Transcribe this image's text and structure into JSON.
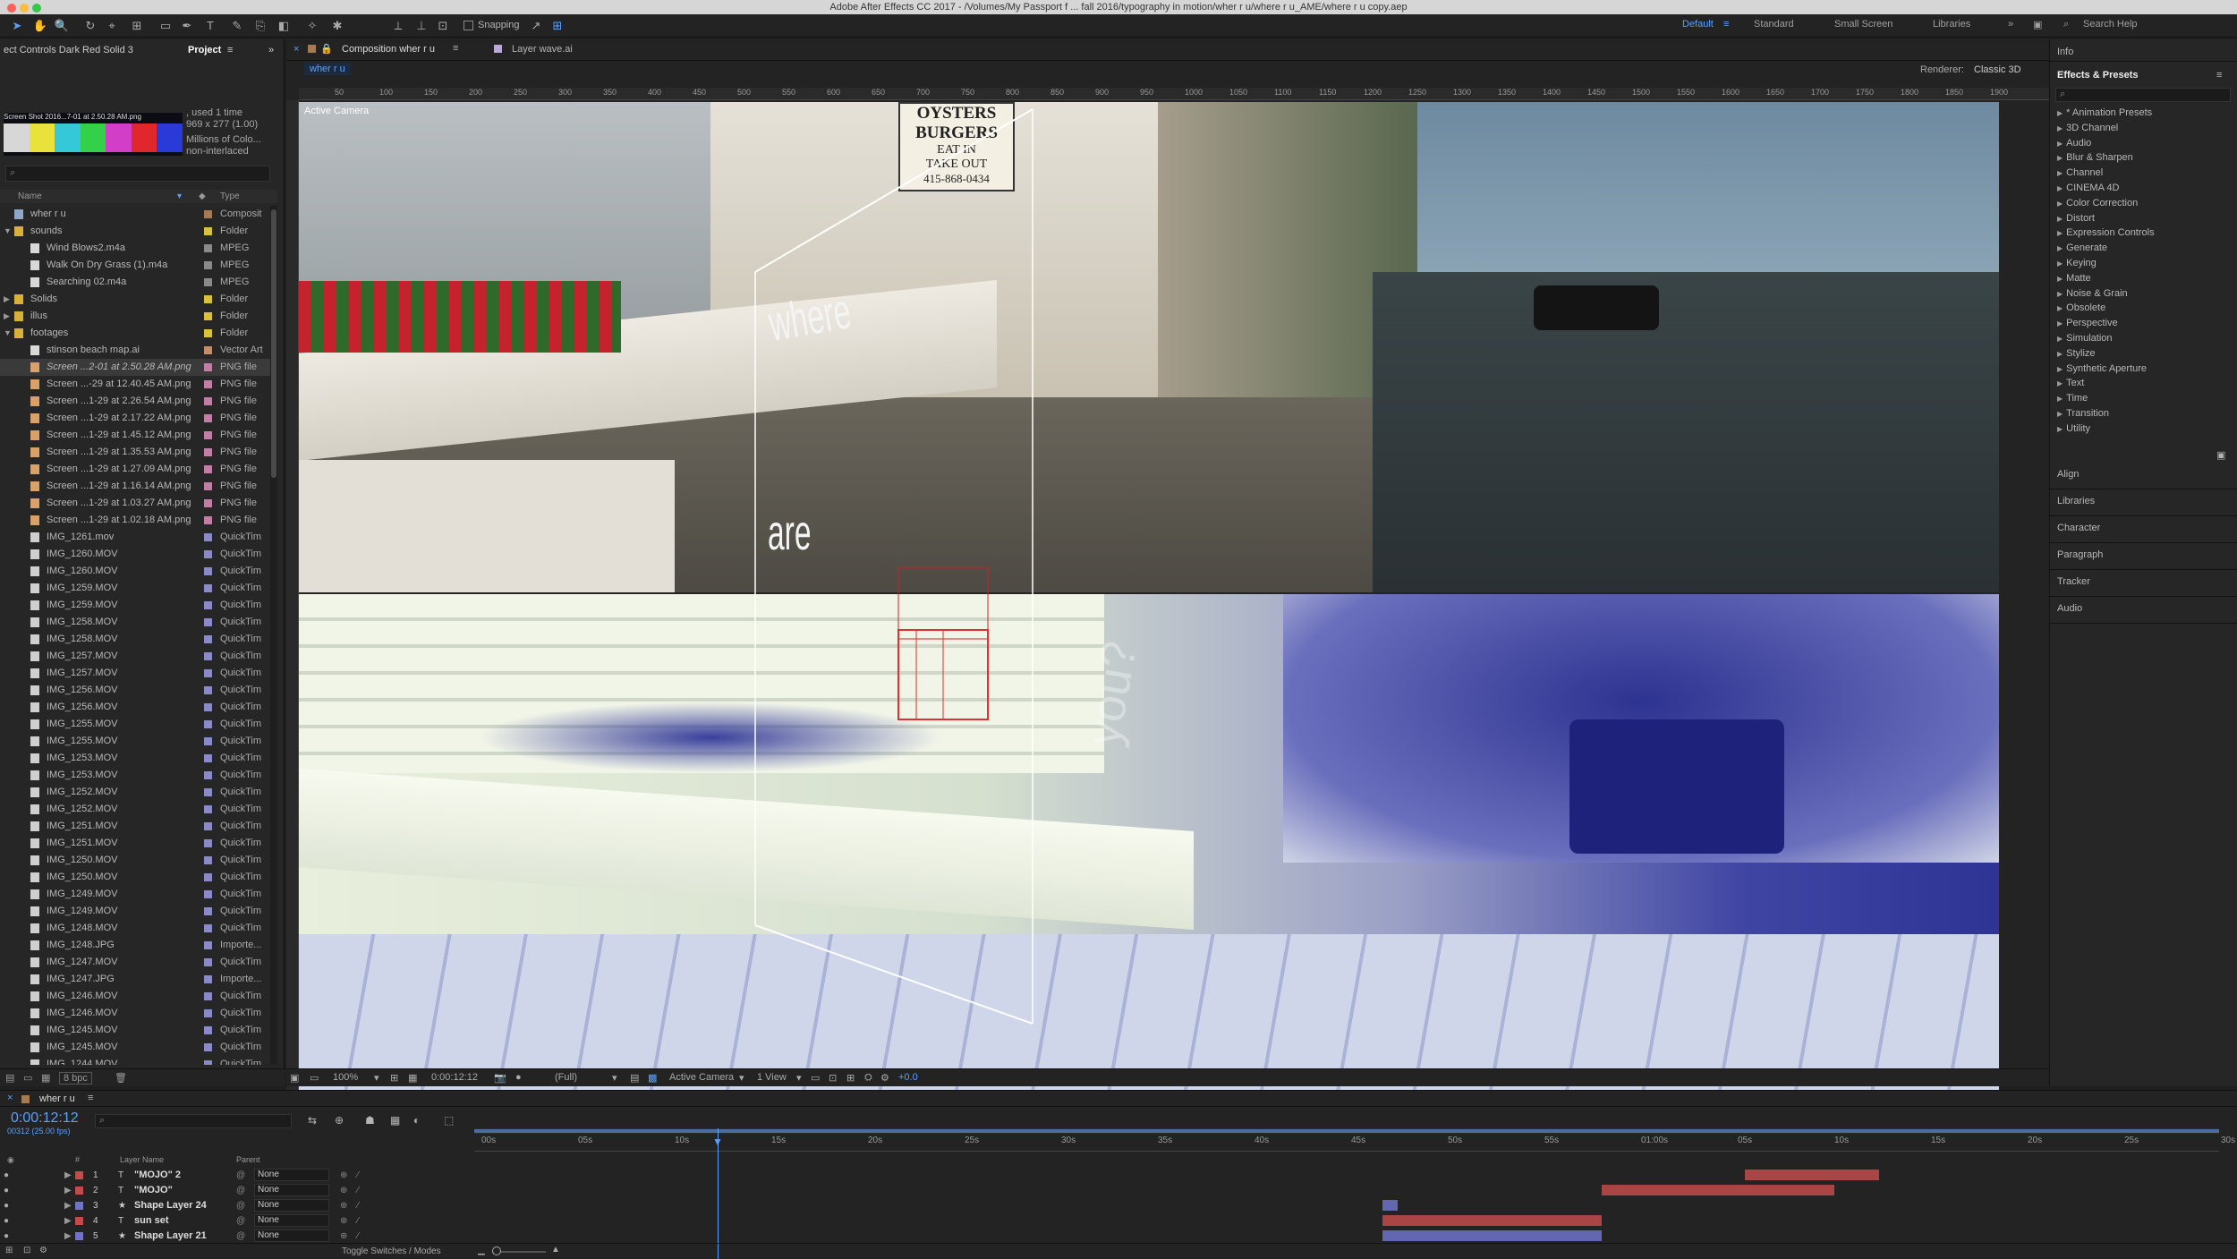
{
  "app": {
    "title": "Adobe After Effects CC 2017 - /Volumes/My Passport f ... fall 2016/typography in motion/wher r u/where r u_AME/where r u copy.aep"
  },
  "toolbar": {
    "snapping": "Snapping",
    "workspaces": [
      "Default",
      "Standard",
      "Small Screen",
      "Libraries"
    ],
    "search_help": "Search Help"
  },
  "left_panel": {
    "tabs": [
      "ect Controls Dark Red Solid 3",
      "Project"
    ],
    "footage_info": {
      "name": "Screen Shot 2016...7-01 at 2.50.28 AM.png",
      "used": ", used 1 time",
      "size": "969 x 277 (1.00)",
      "colors": "Millions of Colo...",
      "interlace": "non-interlaced"
    },
    "columns": {
      "name": "Name",
      "type": "Type"
    },
    "items": [
      {
        "name": "wher r u",
        "type": "Composit",
        "kind": "comp",
        "indent": 0,
        "label": "#a77b52"
      },
      {
        "name": "sounds",
        "type": "Folder",
        "kind": "folder",
        "indent": 0,
        "label": "#d8c23a"
      },
      {
        "name": "Wind Blows2.m4a",
        "type": "MPEG",
        "kind": "file",
        "indent": 1,
        "label": "#8a8a8a"
      },
      {
        "name": "Walk On Dry Grass (1).m4a",
        "type": "MPEG",
        "kind": "file",
        "indent": 1,
        "label": "#8a8a8a"
      },
      {
        "name": "Searching 02.m4a",
        "type": "MPEG",
        "kind": "file",
        "indent": 1,
        "label": "#8a8a8a"
      },
      {
        "name": "Solids",
        "type": "Folder",
        "kind": "folder",
        "indent": 0,
        "label": "#d8c23a"
      },
      {
        "name": "illus",
        "type": "Folder",
        "kind": "folder",
        "indent": 0,
        "label": "#d8c23a"
      },
      {
        "name": "footages",
        "type": "Folder",
        "kind": "folder",
        "indent": 0,
        "label": "#d8c23a"
      },
      {
        "name": "stinson beach map.ai",
        "type": "Vector Art",
        "kind": "file",
        "indent": 1,
        "label": "#c28e6a"
      },
      {
        "name": "Screen ...2-01 at 2.50.28 AM.png",
        "type": "PNG file",
        "kind": "png",
        "indent": 1,
        "label": "#c27fa6",
        "selected": true
      },
      {
        "name": "Screen ...-29 at 12.40.45 AM.png",
        "type": "PNG file",
        "kind": "png",
        "indent": 1,
        "label": "#c27fa6"
      },
      {
        "name": "Screen ...1-29 at 2.26.54 AM.png",
        "type": "PNG file",
        "kind": "png",
        "indent": 1,
        "label": "#c27fa6"
      },
      {
        "name": "Screen ...1-29 at 2.17.22 AM.png",
        "type": "PNG file",
        "kind": "png",
        "indent": 1,
        "label": "#c27fa6"
      },
      {
        "name": "Screen ...1-29 at 1.45.12 AM.png",
        "type": "PNG file",
        "kind": "png",
        "indent": 1,
        "label": "#c27fa6"
      },
      {
        "name": "Screen ...1-29 at 1.35.53 AM.png",
        "type": "PNG file",
        "kind": "png",
        "indent": 1,
        "label": "#c27fa6"
      },
      {
        "name": "Screen ...1-29 at 1.27.09 AM.png",
        "type": "PNG file",
        "kind": "png",
        "indent": 1,
        "label": "#c27fa6"
      },
      {
        "name": "Screen ...1-29 at 1.16.14 AM.png",
        "type": "PNG file",
        "kind": "png",
        "indent": 1,
        "label": "#c27fa6"
      },
      {
        "name": "Screen ...1-29 at 1.03.27 AM.png",
        "type": "PNG file",
        "kind": "png",
        "indent": 1,
        "label": "#c27fa6"
      },
      {
        "name": "Screen ...1-29 at 1.02.18 AM.png",
        "type": "PNG file",
        "kind": "png",
        "indent": 1,
        "label": "#c27fa6"
      },
      {
        "name": "IMG_1261.mov",
        "type": "QuickTim",
        "kind": "mov",
        "indent": 1,
        "label": "#8a8ac8"
      },
      {
        "name": "IMG_1260.MOV",
        "type": "QuickTim",
        "kind": "mov",
        "indent": 1,
        "label": "#8a8ac8"
      },
      {
        "name": "IMG_1260.MOV",
        "type": "QuickTim",
        "kind": "mov",
        "indent": 1,
        "label": "#8a8ac8"
      },
      {
        "name": "IMG_1259.MOV",
        "type": "QuickTim",
        "kind": "mov",
        "indent": 1,
        "label": "#8a8ac8"
      },
      {
        "name": "IMG_1259.MOV",
        "type": "QuickTim",
        "kind": "mov",
        "indent": 1,
        "label": "#8a8ac8"
      },
      {
        "name": "IMG_1258.MOV",
        "type": "QuickTim",
        "kind": "mov",
        "indent": 1,
        "label": "#8a8ac8"
      },
      {
        "name": "IMG_1258.MOV",
        "type": "QuickTim",
        "kind": "mov",
        "indent": 1,
        "label": "#8a8ac8"
      },
      {
        "name": "IMG_1257.MOV",
        "type": "QuickTim",
        "kind": "mov",
        "indent": 1,
        "label": "#8a8ac8"
      },
      {
        "name": "IMG_1257.MOV",
        "type": "QuickTim",
        "kind": "mov",
        "indent": 1,
        "label": "#8a8ac8"
      },
      {
        "name": "IMG_1256.MOV",
        "type": "QuickTim",
        "kind": "mov",
        "indent": 1,
        "label": "#8a8ac8"
      },
      {
        "name": "IMG_1256.MOV",
        "type": "QuickTim",
        "kind": "mov",
        "indent": 1,
        "label": "#8a8ac8"
      },
      {
        "name": "IMG_1255.MOV",
        "type": "QuickTim",
        "kind": "mov",
        "indent": 1,
        "label": "#8a8ac8"
      },
      {
        "name": "IMG_1255.MOV",
        "type": "QuickTim",
        "kind": "mov",
        "indent": 1,
        "label": "#8a8ac8"
      },
      {
        "name": "IMG_1253.MOV",
        "type": "QuickTim",
        "kind": "mov",
        "indent": 1,
        "label": "#8a8ac8"
      },
      {
        "name": "IMG_1253.MOV",
        "type": "QuickTim",
        "kind": "mov",
        "indent": 1,
        "label": "#8a8ac8"
      },
      {
        "name": "IMG_1252.MOV",
        "type": "QuickTim",
        "kind": "mov",
        "indent": 1,
        "label": "#8a8ac8"
      },
      {
        "name": "IMG_1252.MOV",
        "type": "QuickTim",
        "kind": "mov",
        "indent": 1,
        "label": "#8a8ac8"
      },
      {
        "name": "IMG_1251.MOV",
        "type": "QuickTim",
        "kind": "mov",
        "indent": 1,
        "label": "#8a8ac8"
      },
      {
        "name": "IMG_1251.MOV",
        "type": "QuickTim",
        "kind": "mov",
        "indent": 1,
        "label": "#8a8ac8"
      },
      {
        "name": "IMG_1250.MOV",
        "type": "QuickTim",
        "kind": "mov",
        "indent": 1,
        "label": "#8a8ac8"
      },
      {
        "name": "IMG_1250.MOV",
        "type": "QuickTim",
        "kind": "mov",
        "indent": 1,
        "label": "#8a8ac8"
      },
      {
        "name": "IMG_1249.MOV",
        "type": "QuickTim",
        "kind": "mov",
        "indent": 1,
        "label": "#8a8ac8"
      },
      {
        "name": "IMG_1249.MOV",
        "type": "QuickTim",
        "kind": "mov",
        "indent": 1,
        "label": "#8a8ac8"
      },
      {
        "name": "IMG_1248.MOV",
        "type": "QuickTim",
        "kind": "mov",
        "indent": 1,
        "label": "#8a8ac8"
      },
      {
        "name": "IMG_1248.JPG",
        "type": "Importe...",
        "kind": "img",
        "indent": 1,
        "label": "#8a8ac8"
      },
      {
        "name": "IMG_1247.MOV",
        "type": "QuickTim",
        "kind": "mov",
        "indent": 1,
        "label": "#8a8ac8"
      },
      {
        "name": "IMG_1247.JPG",
        "type": "Importe...",
        "kind": "img",
        "indent": 1,
        "label": "#8a8ac8"
      },
      {
        "name": "IMG_1246.MOV",
        "type": "QuickTim",
        "kind": "mov",
        "indent": 1,
        "label": "#8a8ac8"
      },
      {
        "name": "IMG_1246.MOV",
        "type": "QuickTim",
        "kind": "mov",
        "indent": 1,
        "label": "#8a8ac8"
      },
      {
        "name": "IMG_1245.MOV",
        "type": "QuickTim",
        "kind": "mov",
        "indent": 1,
        "label": "#8a8ac8"
      },
      {
        "name": "IMG_1245.MOV",
        "type": "QuickTim",
        "kind": "mov",
        "indent": 1,
        "label": "#8a8ac8"
      },
      {
        "name": "IMG_1244.MOV",
        "type": "QuickTim",
        "kind": "mov",
        "indent": 1,
        "label": "#8a8ac8"
      }
    ],
    "footer_bpc": "8 bpc"
  },
  "viewer": {
    "tabs": [
      "Composition wher r u",
      "Layer wave.ai"
    ],
    "subtab": "wher r u",
    "renderer_label": "Renderer:",
    "renderer_value": "Classic 3D",
    "camera_label": "Active Camera",
    "ruler": [
      "50",
      "100",
      "150",
      "200",
      "250",
      "300",
      "350",
      "400",
      "450",
      "500",
      "550",
      "600",
      "650",
      "700",
      "750",
      "800",
      "850",
      "900",
      "950",
      "1000",
      "1050",
      "1100",
      "1150",
      "1200",
      "1250",
      "1300",
      "1350",
      "1400",
      "1450",
      "1500",
      "1550",
      "1600",
      "1650",
      "1700",
      "1750",
      "1800",
      "1850",
      "1900"
    ],
    "sign": {
      "line1": "OYSTERS",
      "line2": "BURGERS",
      "line3": "EAT IN",
      "line4": "TAKE OUT",
      "line5": "415-868-0434"
    },
    "overlay_words": [
      "where",
      "are",
      "you?"
    ],
    "footer": {
      "zoom": "100%",
      "time": "0:00:12:12",
      "resolution": "(Full)",
      "camera": "Active Camera",
      "views": "1 View",
      "exposure": "+0.0"
    }
  },
  "right_panel": {
    "info": "Info",
    "effects_title": "Effects & Presets",
    "effects": [
      "* Animation Presets",
      "3D Channel",
      "Audio",
      "Blur & Sharpen",
      "Channel",
      "CINEMA 4D",
      "Color Correction",
      "Distort",
      "Expression Controls",
      "Generate",
      "Keying",
      "Matte",
      "Noise & Grain",
      "Obsolete",
      "Perspective",
      "Simulation",
      "Stylize",
      "Synthetic Aperture",
      "Text",
      "Time",
      "Transition",
      "Utility"
    ],
    "panels": [
      "Align",
      "Libraries",
      "Character",
      "Paragraph",
      "Tracker",
      "Audio"
    ]
  },
  "timeline": {
    "tab": "wher r u",
    "timecode": "0:00:12:12",
    "frames": "00312 (25.00 fps)",
    "columns": {
      "num": "#",
      "layer_name": "Layer Name",
      "parent": "Parent"
    },
    "ruler": [
      "00s",
      "05s",
      "10s",
      "15s",
      "20s",
      "25s",
      "30s",
      "35s",
      "40s",
      "45s",
      "50s",
      "55s",
      "01:00s",
      "05s",
      "10s",
      "15s",
      "20s",
      "25s",
      "30s"
    ],
    "layers": [
      {
        "num": "1",
        "kind": "T",
        "name": "\"MOJO\" 2",
        "parent": "None",
        "label": "#c24b4b"
      },
      {
        "num": "2",
        "kind": "T",
        "name": "\"MOJO\"",
        "parent": "None",
        "label": "#c24b4b"
      },
      {
        "num": "3",
        "kind": "★",
        "name": "Shape Layer 24",
        "parent": "None",
        "label": "#6f73c9"
      },
      {
        "num": "4",
        "kind": "T",
        "name": "sun set",
        "parent": "None",
        "label": "#c24b4b"
      },
      {
        "num": "5",
        "kind": "★",
        "name": "Shape Layer 21",
        "parent": "None",
        "label": "#6f73c9"
      }
    ],
    "footer": "Toggle Switches / Modes"
  }
}
